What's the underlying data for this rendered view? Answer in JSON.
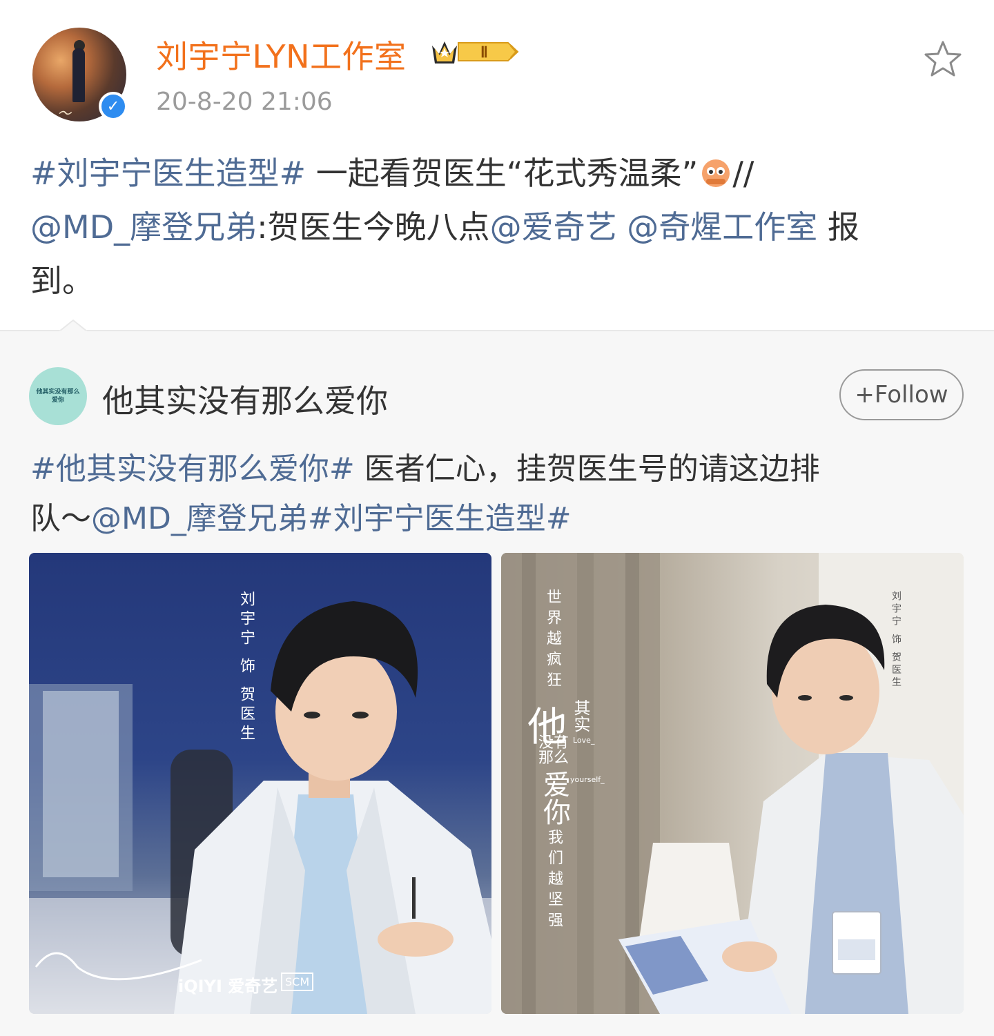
{
  "post": {
    "username": "刘宇宁LYN工作室",
    "vip_level": "Ⅱ",
    "timestamp": "20-8-20 21:06",
    "verified_mark": "✓",
    "text": {
      "hashtag": "#刘宇宁医生造型#",
      "body1": " 一起看贺医生“花式秀温柔”",
      "emoji_name": "peek-emoji",
      "slashes": "//",
      "mention1": "@MD_摩登兄弟",
      "body2": ":贺医生今晚八点",
      "mention2": "@爱奇艺",
      "space": " ",
      "mention3": "@奇煋工作室",
      "body3": " 报",
      "body4": "到。"
    }
  },
  "retweet": {
    "account_name": "他其实没有那么爱你",
    "avatar_text": "他其实没有那么爱你",
    "follow_label": "+Follow",
    "text": {
      "hashtag1": "#他其实没有那么爱你#",
      "body1": " 医者仁心，挂贺医生号的请这边排",
      "body2": "队～",
      "mention": "@MD_摩登兄弟",
      "hashtag2": "#刘宇宁医生造型#"
    },
    "images": [
      {
        "name": "poster-1",
        "vertical_caption": "刘宇宁 饰 贺医生",
        "watermark_iqiyi": "iQIYI 爱奇艺",
        "watermark_scm": "SCM"
      },
      {
        "name": "poster-2",
        "vertical_line1": "世界越疯狂",
        "title_big": "他",
        "title_small": "其实",
        "title_line2": "没有那么",
        "title_line3": "爱你",
        "vertical_line2": "我们越坚强",
        "english1": "Love_",
        "english2": "yourself_",
        "cast_caption": "刘宇宁 饰 贺医生"
      }
    ]
  },
  "colors": {
    "username": "#f2711c",
    "link": "#4f6b94",
    "timestamp": "#9b9b9b",
    "retweet_bg": "#f7f7f7",
    "verified": "#2e8cf0"
  },
  "icons": {
    "favorite": "star-outline-icon",
    "vip": "crown-badge-icon",
    "verified": "verified-check-icon"
  }
}
